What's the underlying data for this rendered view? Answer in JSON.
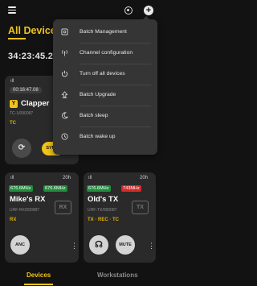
{
  "header": {
    "title": "All Devices",
    "clock": "34:23:45.2",
    "add_symbol": "+",
    "icons": [
      "menu-icon",
      "gear-icon",
      "add-icon"
    ]
  },
  "cards": {
    "clapper": {
      "signal": "ıll",
      "time": "00:16:47.08",
      "name": "Clapper",
      "id": "TC-1/090087",
      "mode": "TC",
      "sync_label": "SYN"
    },
    "mikes_rx": {
      "signal": "ıll",
      "battery": "20h",
      "freq1": "676.6MHz",
      "freq2": "676.6MHz",
      "name": "Mike's RX",
      "id": "UHF-RX/090087",
      "mode": "RX",
      "channel": "RX",
      "anc_label": "ANC",
      "more": "⋮"
    },
    "olds_tx": {
      "signal": "ıll",
      "battery": "20h",
      "freq1": "676.6MHz",
      "freq2": "743MHz",
      "name": "Old's TX",
      "id": "UHF-TX/090087",
      "mode": "TX · REC · TC",
      "channel": "TX",
      "mute_label": "MUTE",
      "more": "⋮"
    }
  },
  "dropdown": {
    "items": [
      {
        "label": "Batch Management",
        "icon": "batch-management-icon"
      },
      {
        "label": "Channel configuration",
        "icon": "antenna-icon"
      },
      {
        "label": "Turn off all devices",
        "icon": "power-icon"
      },
      {
        "label": "Batch Upgrade",
        "icon": "upgrade-icon"
      },
      {
        "label": "Batch sleep",
        "icon": "sleep-icon"
      },
      {
        "label": "Batch wake up",
        "icon": "wake-icon"
      }
    ]
  },
  "tabs": {
    "devices": "Devices",
    "workstations": "Workstations"
  },
  "colors": {
    "accent": "#f0c419",
    "background": "#121212",
    "card": "#2a2a2a",
    "menu": "#353535",
    "freq_green": "#1f8d3c",
    "freq_red": "#d42a2a"
  }
}
